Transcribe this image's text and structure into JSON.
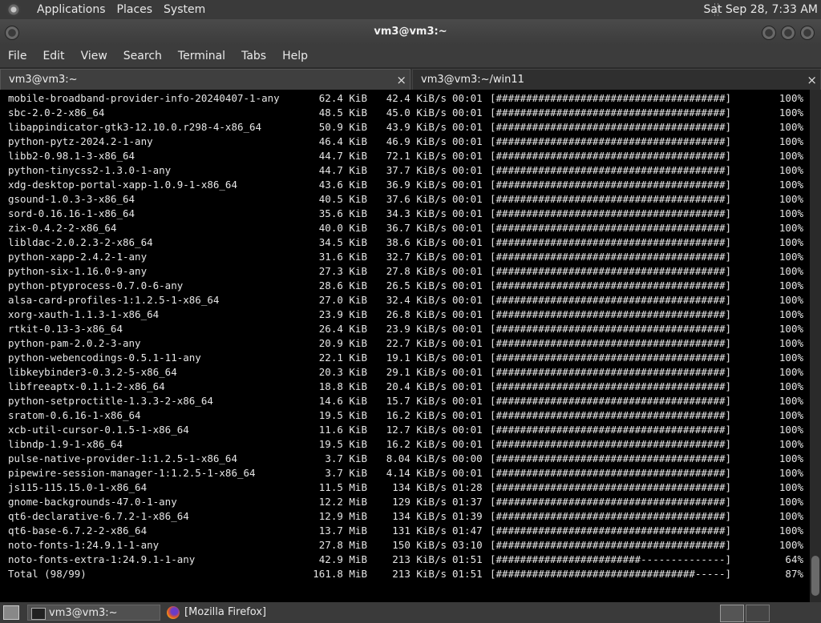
{
  "top_panel": {
    "menus": [
      "Applications",
      "Places",
      "System"
    ],
    "clock": "Sat Sep 28, 7:33 AM"
  },
  "window": {
    "title": "vm3@vm3:~"
  },
  "menubar": [
    "File",
    "Edit",
    "View",
    "Search",
    "Terminal",
    "Tabs",
    "Help"
  ],
  "tabs": [
    {
      "label": "vm3@vm3:~",
      "close": "×"
    },
    {
      "label": "vm3@vm3:~/win11",
      "close": "×"
    }
  ],
  "terminal": {
    "lines": [
      {
        "name": "mobile-broadband-provider-info-20240407-1-any",
        "size": "62.4 KiB",
        "rate": "42.4 KiB/s",
        "time": "00:01",
        "bar": "[######################################]",
        "pct": "100%"
      },
      {
        "name": "sbc-2.0-2-x86_64",
        "size": "48.5 KiB",
        "rate": "45.0 KiB/s",
        "time": "00:01",
        "bar": "[######################################]",
        "pct": "100%"
      },
      {
        "name": "libappindicator-gtk3-12.10.0.r298-4-x86_64",
        "size": "50.9 KiB",
        "rate": "43.9 KiB/s",
        "time": "00:01",
        "bar": "[######################################]",
        "pct": "100%"
      },
      {
        "name": "python-pytz-2024.2-1-any",
        "size": "46.4 KiB",
        "rate": "46.9 KiB/s",
        "time": "00:01",
        "bar": "[######################################]",
        "pct": "100%"
      },
      {
        "name": "libb2-0.98.1-3-x86_64",
        "size": "44.7 KiB",
        "rate": "72.1 KiB/s",
        "time": "00:01",
        "bar": "[######################################]",
        "pct": "100%"
      },
      {
        "name": "python-tinycss2-1.3.0-1-any",
        "size": "44.7 KiB",
        "rate": "37.7 KiB/s",
        "time": "00:01",
        "bar": "[######################################]",
        "pct": "100%"
      },
      {
        "name": "xdg-desktop-portal-xapp-1.0.9-1-x86_64",
        "size": "43.6 KiB",
        "rate": "36.9 KiB/s",
        "time": "00:01",
        "bar": "[######################################]",
        "pct": "100%"
      },
      {
        "name": "gsound-1.0.3-3-x86_64",
        "size": "40.5 KiB",
        "rate": "37.6 KiB/s",
        "time": "00:01",
        "bar": "[######################################]",
        "pct": "100%"
      },
      {
        "name": "sord-0.16.16-1-x86_64",
        "size": "35.6 KiB",
        "rate": "34.3 KiB/s",
        "time": "00:01",
        "bar": "[######################################]",
        "pct": "100%"
      },
      {
        "name": "zix-0.4.2-2-x86_64",
        "size": "40.0 KiB",
        "rate": "36.7 KiB/s",
        "time": "00:01",
        "bar": "[######################################]",
        "pct": "100%"
      },
      {
        "name": "libldac-2.0.2.3-2-x86_64",
        "size": "34.5 KiB",
        "rate": "38.6 KiB/s",
        "time": "00:01",
        "bar": "[######################################]",
        "pct": "100%"
      },
      {
        "name": "python-xapp-2.4.2-1-any",
        "size": "31.6 KiB",
        "rate": "32.7 KiB/s",
        "time": "00:01",
        "bar": "[######################################]",
        "pct": "100%"
      },
      {
        "name": "python-six-1.16.0-9-any",
        "size": "27.3 KiB",
        "rate": "27.8 KiB/s",
        "time": "00:01",
        "bar": "[######################################]",
        "pct": "100%"
      },
      {
        "name": "python-ptyprocess-0.7.0-6-any",
        "size": "28.6 KiB",
        "rate": "26.5 KiB/s",
        "time": "00:01",
        "bar": "[######################################]",
        "pct": "100%"
      },
      {
        "name": "alsa-card-profiles-1:1.2.5-1-x86_64",
        "size": "27.0 KiB",
        "rate": "32.4 KiB/s",
        "time": "00:01",
        "bar": "[######################################]",
        "pct": "100%"
      },
      {
        "name": "xorg-xauth-1.1.3-1-x86_64",
        "size": "23.9 KiB",
        "rate": "26.8 KiB/s",
        "time": "00:01",
        "bar": "[######################################]",
        "pct": "100%"
      },
      {
        "name": "rtkit-0.13-3-x86_64",
        "size": "26.4 KiB",
        "rate": "23.9 KiB/s",
        "time": "00:01",
        "bar": "[######################################]",
        "pct": "100%"
      },
      {
        "name": "python-pam-2.0.2-3-any",
        "size": "20.9 KiB",
        "rate": "22.7 KiB/s",
        "time": "00:01",
        "bar": "[######################################]",
        "pct": "100%"
      },
      {
        "name": "python-webencodings-0.5.1-11-any",
        "size": "22.1 KiB",
        "rate": "19.1 KiB/s",
        "time": "00:01",
        "bar": "[######################################]",
        "pct": "100%"
      },
      {
        "name": "libkeybinder3-0.3.2-5-x86_64",
        "size": "20.3 KiB",
        "rate": "29.1 KiB/s",
        "time": "00:01",
        "bar": "[######################################]",
        "pct": "100%"
      },
      {
        "name": "libfreeaptx-0.1.1-2-x86_64",
        "size": "18.8 KiB",
        "rate": "20.4 KiB/s",
        "time": "00:01",
        "bar": "[######################################]",
        "pct": "100%"
      },
      {
        "name": "python-setproctitle-1.3.3-2-x86_64",
        "size": "14.6 KiB",
        "rate": "15.7 KiB/s",
        "time": "00:01",
        "bar": "[######################################]",
        "pct": "100%"
      },
      {
        "name": "sratom-0.6.16-1-x86_64",
        "size": "19.5 KiB",
        "rate": "16.2 KiB/s",
        "time": "00:01",
        "bar": "[######################################]",
        "pct": "100%"
      },
      {
        "name": "xcb-util-cursor-0.1.5-1-x86_64",
        "size": "11.6 KiB",
        "rate": "12.7 KiB/s",
        "time": "00:01",
        "bar": "[######################################]",
        "pct": "100%"
      },
      {
        "name": "libndp-1.9-1-x86_64",
        "size": "19.5 KiB",
        "rate": "16.2 KiB/s",
        "time": "00:01",
        "bar": "[######################################]",
        "pct": "100%"
      },
      {
        "name": "pulse-native-provider-1:1.2.5-1-x86_64",
        "size": "3.7 KiB",
        "rate": "8.04 KiB/s",
        "time": "00:00",
        "bar": "[######################################]",
        "pct": "100%"
      },
      {
        "name": "pipewire-session-manager-1:1.2.5-1-x86_64",
        "size": "3.7 KiB",
        "rate": "4.14 KiB/s",
        "time": "00:01",
        "bar": "[######################################]",
        "pct": "100%"
      },
      {
        "name": "js115-115.15.0-1-x86_64",
        "size": "11.5 MiB",
        "rate": "134 KiB/s",
        "time": "01:28",
        "bar": "[######################################]",
        "pct": "100%"
      },
      {
        "name": "gnome-backgrounds-47.0-1-any",
        "size": "12.2 MiB",
        "rate": "129 KiB/s",
        "time": "01:37",
        "bar": "[######################################]",
        "pct": "100%"
      },
      {
        "name": "qt6-declarative-6.7.2-1-x86_64",
        "size": "12.9 MiB",
        "rate": "134 KiB/s",
        "time": "01:39",
        "bar": "[######################################]",
        "pct": "100%"
      },
      {
        "name": "qt6-base-6.7.2-2-x86_64",
        "size": "13.7 MiB",
        "rate": "131 KiB/s",
        "time": "01:47",
        "bar": "[######################################]",
        "pct": "100%"
      },
      {
        "name": "noto-fonts-1:24.9.1-1-any",
        "size": "27.8 MiB",
        "rate": "150 KiB/s",
        "time": "03:10",
        "bar": "[######################################]",
        "pct": "100%"
      },
      {
        "name": "noto-fonts-extra-1:24.9.1-1-any",
        "size": "42.9 MiB",
        "rate": "213 KiB/s",
        "time": "01:51",
        "bar": "[########################--------------]",
        "pct": "64%"
      },
      {
        "name": "Total (98/99)",
        "size": "161.8 MiB",
        "rate": "213 KiB/s",
        "time": "01:51",
        "bar": "[#################################-----]",
        "pct": "87%"
      }
    ]
  },
  "taskbar": {
    "items": [
      {
        "label": "vm3@vm3:~",
        "icon": "terminal-icon"
      },
      {
        "label": "[Mozilla Firefox]",
        "icon": "firefox-icon"
      }
    ]
  }
}
